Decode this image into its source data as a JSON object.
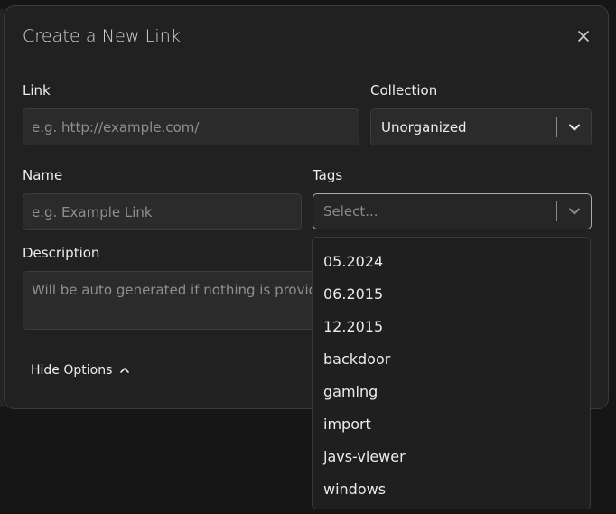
{
  "dialog": {
    "title": "Create a New Link",
    "close_icon": "close-icon"
  },
  "fields": {
    "link": {
      "label": "Link",
      "placeholder": "e.g. http://example.com/",
      "value": ""
    },
    "collection": {
      "label": "Collection",
      "selected": "Unorganized",
      "icon": "chevron-down-icon"
    },
    "name": {
      "label": "Name",
      "placeholder": "e.g. Example Link",
      "value": ""
    },
    "tags": {
      "label": "Tags",
      "placeholder": "Select...",
      "icon": "chevron-down-icon",
      "options": [
        "05.2024",
        "06.2015",
        "12.2015",
        "backdoor",
        "gaming",
        "import",
        "javs-viewer",
        "windows"
      ]
    },
    "description": {
      "label": "Description",
      "placeholder": "Will be auto generated if nothing is provided."
    }
  },
  "options_toggle": {
    "label": "Hide Options",
    "icon": "chevron-up-icon"
  },
  "colors": {
    "focus_border": "#7fb9d0",
    "surface": "#212121",
    "input_bg": "#2b2b2b"
  }
}
